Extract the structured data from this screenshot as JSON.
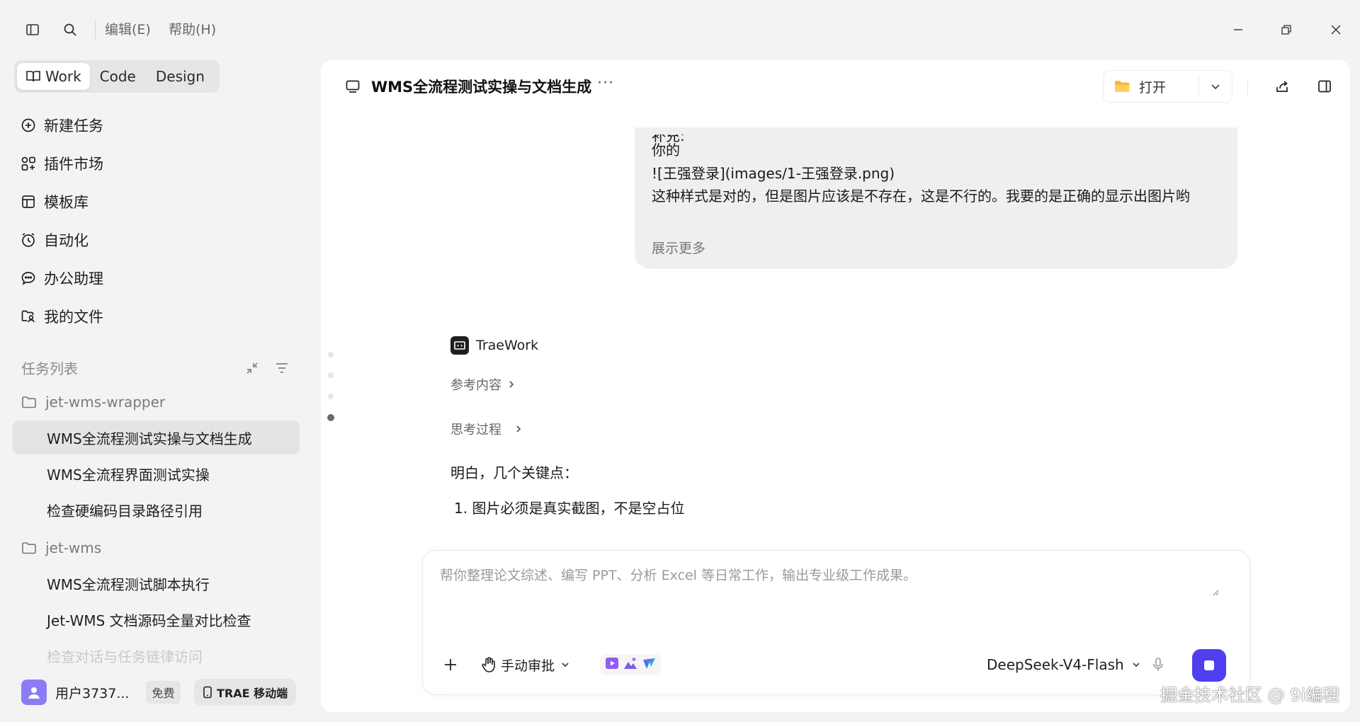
{
  "titlebar": {
    "menu_edit": "编辑(E)",
    "menu_help": "帮助(H)"
  },
  "sidebar": {
    "modes": [
      {
        "label": "Work",
        "active": true
      },
      {
        "label": "Code",
        "active": false
      },
      {
        "label": "Design",
        "active": false
      }
    ],
    "nav": [
      {
        "label": "新建任务",
        "icon": "plus-circle-icon"
      },
      {
        "label": "插件市场",
        "icon": "grid-icon"
      },
      {
        "label": "模板库",
        "icon": "template-icon"
      },
      {
        "label": "自动化",
        "icon": "clock-icon"
      },
      {
        "label": "办公助理",
        "icon": "chat-icon"
      },
      {
        "label": "我的文件",
        "icon": "folder-user-icon"
      }
    ],
    "task_list_title": "任务列表",
    "groups": [
      {
        "folder": "jet-wms-wrapper",
        "tasks": [
          "WMS全流程测试实操与文档生成",
          "WMS全流程界面测试实操",
          "检查硬编码目录路径引用"
        ]
      },
      {
        "folder": "jet-wms",
        "tasks": [
          "WMS全流程测试脚本执行",
          "Jet-WMS 文档源码全量对比检查",
          "检查对话与任务链律访问"
        ]
      }
    ],
    "user": {
      "name": "用户3737...",
      "plan": "免费"
    },
    "mobile_label": "TRAE 移动端"
  },
  "conversation": {
    "title": "WMS全流程测试实操与文档生成",
    "more": "···",
    "open_label": "打开",
    "user_message": {
      "lines": [
        "补充:",
        "你的",
        "![王强登录](images/1-王强登录.png)",
        "这种样式是对的，但是图片应该是不存在，这是不行的。我要的是正确的显示出图片哟"
      ],
      "show_more": "展示更多"
    },
    "assistant": {
      "name": "TraeWork",
      "references": "参考内容",
      "thinking": "思考过程",
      "intro": "明白，几个关键点：",
      "points": [
        "1. 图片必须是真实截图，不是空占位"
      ]
    }
  },
  "composer": {
    "placeholder": "帮你整理论文综述、编写 PPT、分析 Excel 等日常工作，输出专业级工作成果。",
    "approval_label": "手动审批",
    "model": "DeepSeek-V4-Flash"
  },
  "watermark": "掘金技术社区 @ 9i编程",
  "colors": {
    "accent": "#4f3ff0",
    "avatar": "#8b7cf6",
    "background": "#f3f3f3"
  }
}
